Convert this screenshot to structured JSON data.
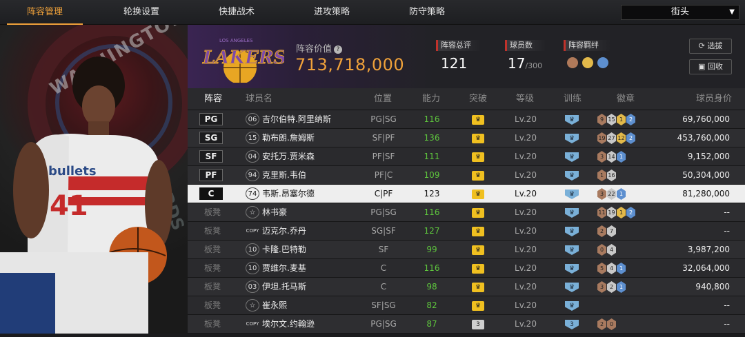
{
  "nav": {
    "tabs": [
      "阵容管理",
      "轮换设置",
      "快捷战术",
      "进攻策略",
      "防守策略"
    ],
    "active": "阵容管理",
    "mode_select": "街头"
  },
  "featured_player": {
    "jersey_text": "bullets",
    "jersey_number": "41",
    "backdrop_team": "WASHINGTON",
    "backdrop_suffix": "ZARDS"
  },
  "team": {
    "logo_text": "LAKERS",
    "logo_small": "LOS ANGELES",
    "value_label": "阵容价值",
    "value": "713,718,000",
    "rating_label": "阵容总评",
    "rating": "121",
    "players_label": "球员数",
    "players": "17",
    "players_max": "/300",
    "bond_label": "阵容羁绊"
  },
  "buttons": {
    "select": "选拔",
    "recycle": "回收"
  },
  "columns": [
    "阵容",
    "球员名",
    "位置",
    "能力",
    "突破",
    "等级",
    "训练",
    "徽章",
    "球员身价"
  ],
  "rows": [
    {
      "slot": "PG",
      "num": "06",
      "name": "吉尔伯特.阿里纳斯",
      "pos": "PG|SG",
      "ability": "116",
      "break": "",
      "level": "Lv.20",
      "train": "",
      "badges": [
        [
          "br",
          "9"
        ],
        [
          "sl",
          "15"
        ],
        [
          "gd",
          "1"
        ],
        [
          "hf",
          "2"
        ]
      ],
      "value": "69,760,000"
    },
    {
      "slot": "SG",
      "num": "15",
      "name": "勒布朗.詹姆斯",
      "pos": "SF|PF",
      "ability": "136",
      "break": "",
      "level": "Lv.20",
      "train": "",
      "badges": [
        [
          "br",
          "19"
        ],
        [
          "sl",
          "27"
        ],
        [
          "gd",
          "12"
        ],
        [
          "hf",
          "2"
        ]
      ],
      "value": "453,760,000"
    },
    {
      "slot": "SF",
      "num": "04",
      "name": "安托万.贾米森",
      "pos": "PF|SF",
      "ability": "111",
      "break": "",
      "level": "Lv.20",
      "train": "",
      "badges": [
        [
          "br",
          "3"
        ],
        [
          "sl",
          "14"
        ],
        [
          "hf",
          "1"
        ]
      ],
      "value": "9,152,000"
    },
    {
      "slot": "PF",
      "num": "94",
      "name": "克里斯.韦伯",
      "pos": "PF|C",
      "ability": "109",
      "break": "",
      "level": "Lv.20",
      "train": "",
      "badges": [
        [
          "br",
          "1"
        ],
        [
          "sl",
          "16"
        ]
      ],
      "value": "50,304,000"
    },
    {
      "slot": "C",
      "num": "74",
      "name": "韦斯.昂塞尔德",
      "pos": "C|PF",
      "ability": "123",
      "break": "",
      "level": "Lv.20",
      "train": "",
      "badges": [
        [
          "br",
          "3"
        ],
        [
          "sl",
          "22"
        ],
        [
          "hf",
          "1"
        ]
      ],
      "value": "81,280,000",
      "selected": true
    },
    {
      "slot": "板凳",
      "num": "☆",
      "name": "林书豪",
      "pos": "PG|SG",
      "ability": "116",
      "break": "",
      "level": "Lv.20",
      "train": "",
      "badges": [
        [
          "br",
          "11"
        ],
        [
          "sl",
          "19"
        ],
        [
          "gd",
          "1"
        ],
        [
          "hf",
          "2"
        ]
      ],
      "value": "--"
    },
    {
      "slot": "板凳",
      "num": "COPY",
      "name": "迈克尔.乔丹",
      "pos": "SG|SF",
      "ability": "127",
      "break": "",
      "level": "Lv.20",
      "train": "",
      "badges": [
        [
          "br",
          "2"
        ],
        [
          "sl",
          "7"
        ]
      ],
      "value": "--"
    },
    {
      "slot": "板凳",
      "num": "10",
      "name": "卡隆.巴特勒",
      "pos": "SF",
      "ability": "99",
      "break": "",
      "level": "Lv.20",
      "train": "",
      "badges": [
        [
          "br",
          "0"
        ],
        [
          "sl",
          "4"
        ]
      ],
      "value": "3,987,200"
    },
    {
      "slot": "板凳",
      "num": "10",
      "name": "贾维尔.麦基",
      "pos": "C",
      "ability": "116",
      "break": "",
      "level": "Lv.20",
      "train": "",
      "badges": [
        [
          "br",
          "5"
        ],
        [
          "sl",
          "4"
        ],
        [
          "hf",
          "1"
        ]
      ],
      "value": "32,064,000"
    },
    {
      "slot": "板凳",
      "num": "03",
      "name": "伊坦.托马斯",
      "pos": "C",
      "ability": "98",
      "break": "",
      "level": "Lv.20",
      "train": "",
      "badges": [
        [
          "br",
          "3"
        ],
        [
          "sl",
          "2"
        ],
        [
          "hf",
          "1"
        ]
      ],
      "value": "940,800"
    },
    {
      "slot": "板凳",
      "num": "☆",
      "name": "崔永熙",
      "pos": "SF|SG",
      "ability": "82",
      "break": "",
      "level": "Lv.20",
      "train": "",
      "badges": [],
      "value": "--"
    },
    {
      "slot": "板凳",
      "num": "COPY",
      "name": "埃尔文.约翰逊",
      "pos": "PG|SG",
      "ability": "87",
      "break": "3",
      "level": "Lv.20",
      "train": "3",
      "badges": [
        [
          "br",
          "2"
        ],
        [
          "br",
          "0"
        ]
      ],
      "value": "--"
    }
  ],
  "colors": {
    "accent": "#f0a23a",
    "ability": "#5ec63d",
    "break": "#f0c020",
    "train": "#7ab0d8",
    "stat_marker": "#c0322b"
  }
}
